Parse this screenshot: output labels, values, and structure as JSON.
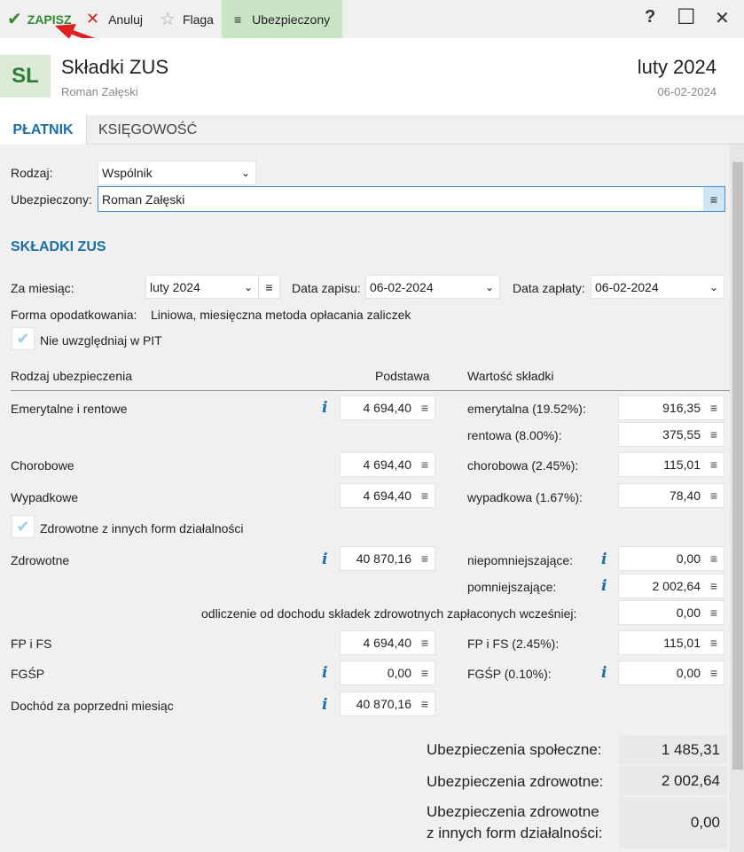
{
  "toolbar": {
    "save": "ZAPISZ",
    "cancel": "Anuluj",
    "flag": "Flaga",
    "insured": "Ubezpieczony",
    "help": "?",
    "maximize": "☐",
    "close": "✕"
  },
  "header": {
    "avatar": "SL",
    "title": "Składki ZUS",
    "subtitle": "Roman Załęski",
    "month": "luty 2024",
    "date": "06-02-2024"
  },
  "tabs": [
    "PŁATNIK",
    "KSIĘGOWOŚĆ"
  ],
  "form": {
    "rodzaj_label": "Rodzaj:",
    "rodzaj_value": "Wspólnik",
    "ubezpieczony_label": "Ubezpieczony:",
    "ubezpieczony_value": "Roman Załęski"
  },
  "section": {
    "title": "SKŁADKI ZUS",
    "za_miesiac_label": "Za miesiąc:",
    "za_miesiac_value": "luty 2024",
    "data_zapisu_label": "Data zapisu:",
    "data_zapisu_value": "06-02-2024",
    "data_zaplaty_label": "Data zapłaty:",
    "data_zaplaty_value": "06-02-2024",
    "forma_label": "Forma opodatkowania:",
    "forma_value": "Liniowa, miesięczna metoda opłacania zaliczek",
    "nie_uwzgledniaj": "Nie uwzględniaj w PIT",
    "col_rodzaj": "Rodzaj ubezpieczenia",
    "col_podstawa": "Podstawa",
    "col_wartosc": "Wartość składki"
  },
  "rows": {
    "emerytalne_label": "Emerytalne i rentowe",
    "emerytalne_podstawa": "4 694,40",
    "emerytalna_label": "emerytalna (19.52%):",
    "emerytalna_value": "916,35",
    "rentowa_label": "rentowa (8.00%):",
    "rentowa_value": "375,55",
    "chorobowe_label": "Chorobowe",
    "chorobowe_podstawa": "4 694,40",
    "chorobowa_label": "chorobowa (2.45%):",
    "chorobowa_value": "115,01",
    "wypadkowe_label": "Wypadkowe",
    "wypadkowe_podstawa": "4 694,40",
    "wypadkowa_label": "wypadkowa (1.67%):",
    "wypadkowa_value": "78,40",
    "zdrowotne_inne": "Zdrowotne z innych form działalności",
    "zdrowotne_label": "Zdrowotne",
    "zdrowotne_podstawa": "40 870,16",
    "niepomniejszajace_label": "niepomniejszające:",
    "niepomniejszajace_value": "0,00",
    "pomniejszajace_label": "pomniejszające:",
    "pomniejszajace_value": "2 002,64",
    "odliczenie_label": "odliczenie od dochodu składek zdrowotnych zapłaconych wcześniej:",
    "odliczenie_value": "0,00",
    "fpfs_label": "FP i FS",
    "fpfs_podstawa": "4 694,40",
    "fpfs_skladka_label": "FP i FS (2.45%):",
    "fpfs_skladka_value": "115,01",
    "fgsp_label": "FGŚP",
    "fgsp_podstawa": "0,00",
    "fgsp_skladka_label": "FGŚP (0.10%):",
    "fgsp_skladka_value": "0,00",
    "dochod_label": "Dochód za poprzedni miesiąc",
    "dochod_value": "40 870,16"
  },
  "summary": {
    "spoleczne_label": "Ubezpieczenia społeczne:",
    "spoleczne_value": "1 485,31",
    "zdrowotne_label": "Ubezpieczenia zdrowotne:",
    "zdrowotne_value": "2 002,64",
    "zdrowotne_inne_label_1": "Ubezpieczenia zdrowotne",
    "zdrowotne_inne_label_2": "z innych form działalności:",
    "zdrowotne_inne_value": "0,00"
  },
  "icons": {
    "menu": "≡",
    "info": "i",
    "chevron": "⌄",
    "check": "✔",
    "x": "✕",
    "star": "☆"
  },
  "colors": {
    "accent_blue": "#1b6fa8",
    "save_green": "#2e8b2e",
    "cancel_red": "#d62020",
    "insured_bg": "#c9e4c5"
  }
}
